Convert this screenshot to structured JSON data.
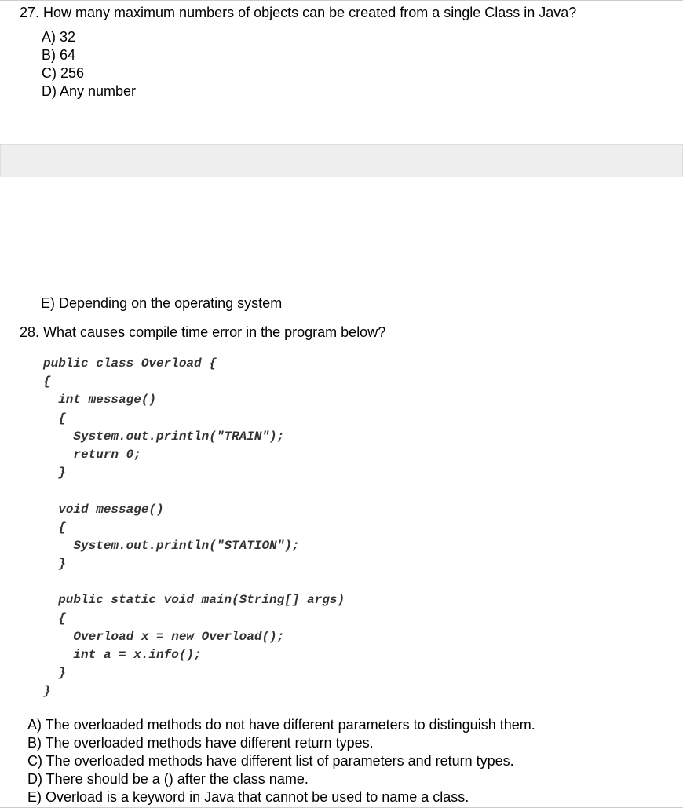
{
  "q27": {
    "text": "27. How many maximum numbers of objects can be created from a single Class in Java?",
    "options": {
      "a": "A) 32",
      "b": "B) 64",
      "c": "C) 256",
      "d": "D) Any number",
      "e": "E) Depending on the operating system"
    }
  },
  "q28": {
    "text": "28. What causes compile time error in the program below?",
    "code": "public class Overload {\n{\n  int message()\n  {\n    System.out.println(\"TRAIN\");\n    return 0;\n  }\n\n  void message()\n  {\n    System.out.println(\"STATION\");\n  }\n\n  public static void main(String[] args)\n  {\n    Overload x = new Overload();\n    int a = x.info();\n  }\n}",
    "options": {
      "a": "A) The overloaded methods do not have different parameters to distinguish them.",
      "b": "B) The overloaded methods have different return types.",
      "c": "C) The overloaded methods have different list of parameters and return types.",
      "d": "D) There should be a () after the class name.",
      "e": "E) Overload is a keyword in Java that cannot be used to name a class."
    }
  }
}
